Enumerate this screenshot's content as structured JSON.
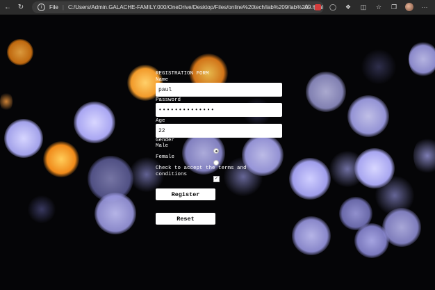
{
  "browser": {
    "address_label": "File",
    "url": "C:/Users/Admin.GALACHE-FAMILY.000/OneDrive/Desktop/Files/online%20tech/lab%209/lab%209.html"
  },
  "form": {
    "title": "REGISTRATION FORM",
    "name_label": "Name",
    "name_value": "paul",
    "password_label": "Password",
    "password_value": "••••••••••••••",
    "age_label": "Age",
    "age_value": "22",
    "gender_label": "Gender",
    "male_label": "Male",
    "female_label": "Female",
    "selected_gender": "Male",
    "terms_label": "Check to accept the terms and conditions",
    "terms_checked": true,
    "register_label": "Register",
    "reset_label": "Reset"
  },
  "colors": {
    "background": "#050507",
    "warm_bokeh": "#ffa53a",
    "cool_bokeh": "#b9b8ff"
  }
}
